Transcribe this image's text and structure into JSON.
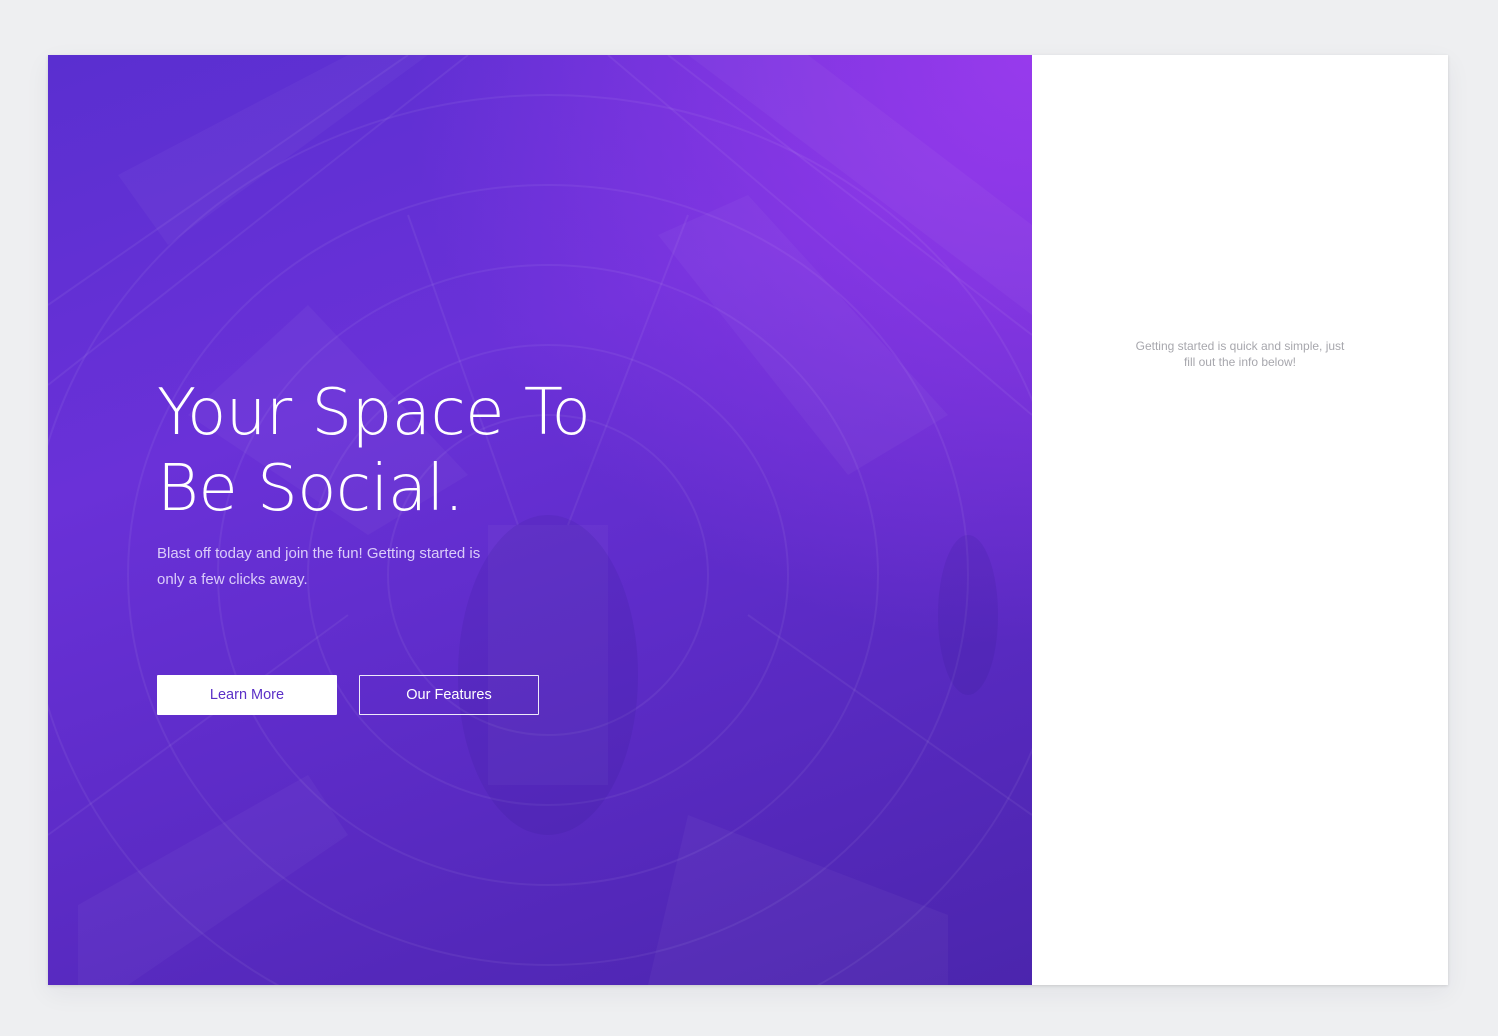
{
  "hero": {
    "title_line_1": "Your Space To",
    "title_line_2": "Be Social.",
    "subtitle": "Blast off today and join the fun! Getting started is only a few clicks away.",
    "primary_button_label": "Learn More",
    "secondary_button_label": "Our Features",
    "background_image": "space-station-interior-photo"
  },
  "signup_panel": {
    "intro_text": "Getting started is quick and simple, just fill out the info below!"
  },
  "colors": {
    "page_background": "#eeeff1",
    "hero_gradient_start": "#5a2fd0",
    "hero_gradient_end": "#4b25ad",
    "hero_accent": "#a03cf0",
    "primary_button_text": "#5b30c7",
    "panel_background": "#ffffff",
    "muted_text": "#a7a7ad"
  }
}
